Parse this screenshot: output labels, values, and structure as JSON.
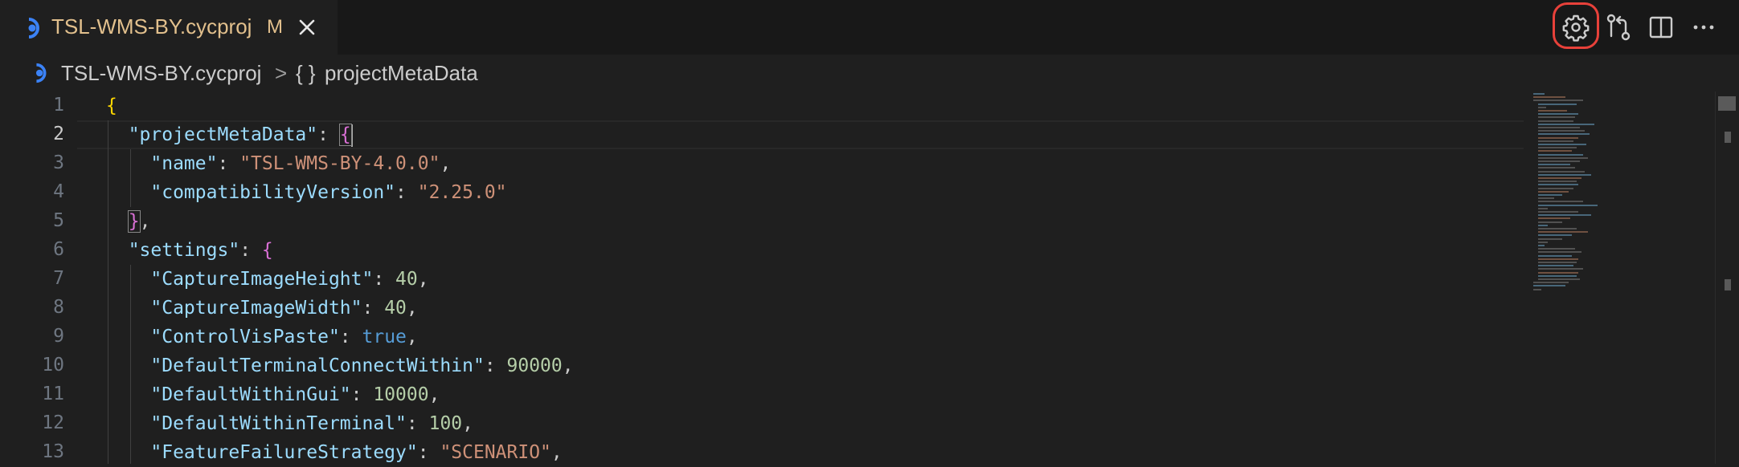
{
  "tab": {
    "title": "TSL-WMS-BY.cycproj",
    "modified_badge": "M"
  },
  "actions": {
    "icons": [
      "gear-icon",
      "compare-changes-icon",
      "split-editor-icon",
      "more-actions-icon"
    ]
  },
  "breadcrumb": {
    "file": "TSL-WMS-BY.cycproj",
    "separator": ">",
    "symbol_glyph": "{ }",
    "symbol": "projectMetaData"
  },
  "editor": {
    "active_line": 2,
    "lines": [
      {
        "number": "1",
        "tokens": [
          {
            "t": "{",
            "c": "brace-gold"
          }
        ]
      },
      {
        "number": "2",
        "tokens": [
          {
            "t": "  "
          },
          {
            "t": "\"projectMetaData\"",
            "c": "tok-key"
          },
          {
            "t": ": "
          },
          {
            "t": "{",
            "c": "brace-pink match"
          }
        ]
      },
      {
        "number": "3",
        "tokens": [
          {
            "t": "    "
          },
          {
            "t": "\"name\"",
            "c": "tok-key"
          },
          {
            "t": ": "
          },
          {
            "t": "\"TSL-WMS-BY-4.0.0\"",
            "c": "tok-str"
          },
          {
            "t": ","
          }
        ]
      },
      {
        "number": "4",
        "tokens": [
          {
            "t": "    "
          },
          {
            "t": "\"compatibilityVersion\"",
            "c": "tok-key"
          },
          {
            "t": ": "
          },
          {
            "t": "\"2.25.0\"",
            "c": "tok-str"
          }
        ]
      },
      {
        "number": "5",
        "tokens": [
          {
            "t": "  "
          },
          {
            "t": "}",
            "c": "brace-pink match"
          },
          {
            "t": ","
          }
        ]
      },
      {
        "number": "6",
        "tokens": [
          {
            "t": "  "
          },
          {
            "t": "\"settings\"",
            "c": "tok-key"
          },
          {
            "t": ": "
          },
          {
            "t": "{",
            "c": "brace-pink"
          }
        ]
      },
      {
        "number": "7",
        "tokens": [
          {
            "t": "    "
          },
          {
            "t": "\"CaptureImageHeight\"",
            "c": "tok-key"
          },
          {
            "t": ": "
          },
          {
            "t": "40",
            "c": "tok-num"
          },
          {
            "t": ","
          }
        ]
      },
      {
        "number": "8",
        "tokens": [
          {
            "t": "    "
          },
          {
            "t": "\"CaptureImageWidth\"",
            "c": "tok-key"
          },
          {
            "t": ": "
          },
          {
            "t": "40",
            "c": "tok-num"
          },
          {
            "t": ","
          }
        ]
      },
      {
        "number": "9",
        "tokens": [
          {
            "t": "    "
          },
          {
            "t": "\"ControlVisPaste\"",
            "c": "tok-key"
          },
          {
            "t": ": "
          },
          {
            "t": "true",
            "c": "tok-bool"
          },
          {
            "t": ","
          }
        ]
      },
      {
        "number": "10",
        "tokens": [
          {
            "t": "    "
          },
          {
            "t": "\"DefaultTerminalConnectWithin\"",
            "c": "tok-key"
          },
          {
            "t": ": "
          },
          {
            "t": "90000",
            "c": "tok-num"
          },
          {
            "t": ","
          }
        ]
      },
      {
        "number": "11",
        "tokens": [
          {
            "t": "    "
          },
          {
            "t": "\"DefaultWithinGui\"",
            "c": "tok-key"
          },
          {
            "t": ": "
          },
          {
            "t": "10000",
            "c": "tok-num"
          },
          {
            "t": ","
          }
        ]
      },
      {
        "number": "12",
        "tokens": [
          {
            "t": "    "
          },
          {
            "t": "\"DefaultWithinTerminal\"",
            "c": "tok-key"
          },
          {
            "t": ": "
          },
          {
            "t": "100",
            "c": "tok-num"
          },
          {
            "t": ","
          }
        ]
      },
      {
        "number": "13",
        "tokens": [
          {
            "t": "    "
          },
          {
            "t": "\"FeatureFailureStrategy\"",
            "c": "tok-key"
          },
          {
            "t": ": "
          },
          {
            "t": "\"SCENARIO\"",
            "c": "tok-str"
          },
          {
            "t": ","
          }
        ]
      }
    ]
  },
  "colors": {
    "background": "#1f1f1f",
    "tab_modified": "#e2c08d",
    "highlight_ring": "#e8413a",
    "key": "#9cdcfe",
    "string": "#ce9178",
    "number": "#b5cea8",
    "boolean": "#569cd6"
  }
}
